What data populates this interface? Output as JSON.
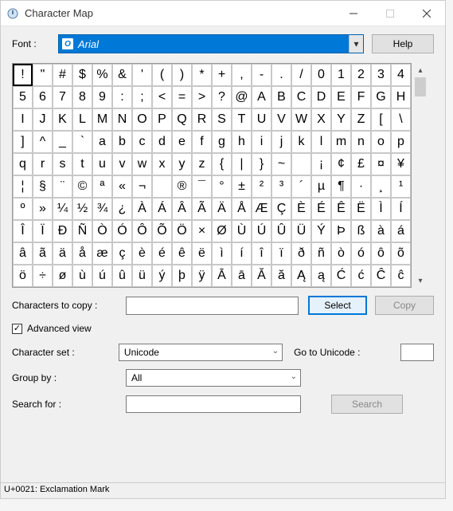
{
  "window": {
    "title": "Character Map"
  },
  "font_row": {
    "label": "Font :",
    "selected": "Arial",
    "help_label": "Help"
  },
  "grid": {
    "selected_index": 0,
    "chars": [
      "!",
      "\"",
      "#",
      "$",
      "%",
      "&",
      "'",
      "(",
      ")",
      "*",
      "+",
      ",",
      "-",
      ".",
      "/",
      "0",
      "1",
      "2",
      "3",
      "4",
      "5",
      "6",
      "7",
      "8",
      "9",
      ":",
      ";",
      "<",
      "=",
      ">",
      "?",
      "@",
      "A",
      "B",
      "C",
      "D",
      "E",
      "F",
      "G",
      "H",
      "I",
      "J",
      "K",
      "L",
      "M",
      "N",
      "O",
      "P",
      "Q",
      "R",
      "S",
      "T",
      "U",
      "V",
      "W",
      "X",
      "Y",
      "Z",
      "[",
      "\\",
      "]",
      "^",
      "_",
      "`",
      "a",
      "b",
      "c",
      "d",
      "e",
      "f",
      "g",
      "h",
      "i",
      "j",
      "k",
      "l",
      "m",
      "n",
      "o",
      "p",
      "q",
      "r",
      "s",
      "t",
      "u",
      "v",
      "w",
      "x",
      "y",
      "z",
      "{",
      "|",
      "}",
      "~",
      "",
      "¡",
      "¢",
      "£",
      "¤",
      "¥",
      "¦",
      "§",
      "¨",
      "©",
      "ª",
      "«",
      "¬",
      "­",
      "®",
      "¯",
      "°",
      "±",
      "²",
      "³",
      "´",
      "µ",
      "¶",
      "·",
      "¸",
      "¹",
      "º",
      "»",
      "¼",
      "½",
      "¾",
      "¿",
      "À",
      "Á",
      "Â",
      "Ã",
      "Ä",
      "Å",
      "Æ",
      "Ç",
      "È",
      "É",
      "Ê",
      "Ë",
      "Ì",
      "Í",
      "Î",
      "Ï",
      "Ð",
      "Ñ",
      "Ò",
      "Ó",
      "Ô",
      "Õ",
      "Ö",
      "×",
      "Ø",
      "Ù",
      "Ú",
      "Û",
      "Ü",
      "Ý",
      "Þ",
      "ß",
      "à",
      "á",
      "â",
      "ã",
      "ä",
      "å",
      "æ",
      "ç",
      "è",
      "é",
      "ê",
      "ë",
      "ì",
      "í",
      "î",
      "ï",
      "ð",
      "ñ",
      "ò",
      "ó",
      "ô",
      "õ",
      "ö",
      "÷",
      "ø",
      "ù",
      "ú",
      "û",
      "ü",
      "ý",
      "þ",
      "ÿ",
      "Ā",
      "ā",
      "Ă",
      "ă",
      "Ą",
      "ą",
      "Ć",
      "ć",
      "Ĉ",
      "ĉ"
    ]
  },
  "copy_row": {
    "label": "Characters to copy :",
    "value": "",
    "select_label": "Select",
    "copy_label": "Copy"
  },
  "advanced_view": {
    "checked": true,
    "label": "Advanced view"
  },
  "charset_row": {
    "label": "Character set :",
    "value": "Unicode",
    "goto_label": "Go to Unicode :",
    "goto_value": ""
  },
  "groupby_row": {
    "label": "Group by :",
    "value": "All"
  },
  "search_row": {
    "label": "Search for :",
    "value": "",
    "button_label": "Search"
  },
  "statusbar": {
    "text": "U+0021: Exclamation Mark"
  }
}
